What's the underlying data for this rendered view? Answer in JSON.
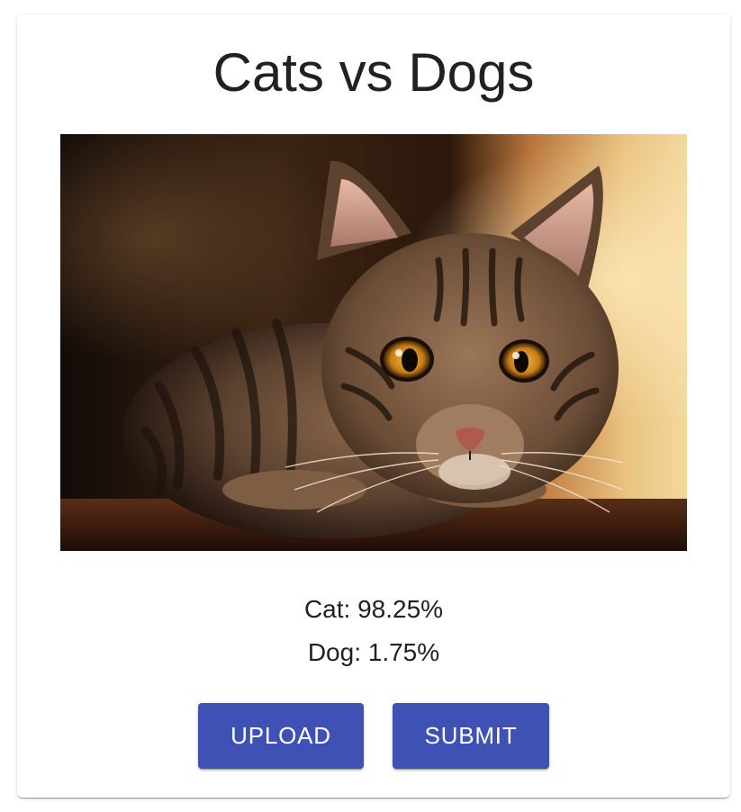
{
  "header": {
    "title": "Cats vs Dogs"
  },
  "image": {
    "subject": "tabby cat photo"
  },
  "predictions": {
    "cat": "Cat: 98.25%",
    "dog": "Dog: 1.75%"
  },
  "actions": {
    "upload_label": "UPLOAD",
    "submit_label": "SUBMIT"
  },
  "colors": {
    "primary_button": "#3f51b5",
    "text": "#212121",
    "background": "#ffffff"
  }
}
